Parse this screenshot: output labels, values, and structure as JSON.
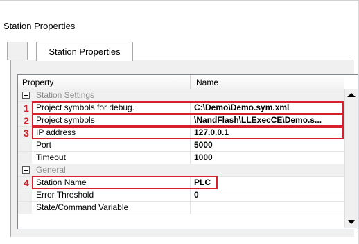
{
  "page": {
    "title": "Station Properties"
  },
  "tabs": [
    {
      "label": "Station Properties",
      "active": true
    }
  ],
  "grid": {
    "headers": {
      "property": "Property",
      "name": "Name"
    },
    "categories": {
      "station_settings": "Station Settings",
      "general": "General"
    },
    "rows": [
      {
        "property": "Project symbols for debug.",
        "value": "C:\\Demo\\Demo.sym.xml"
      },
      {
        "property": "Project symbols",
        "value": "\\NandFlash\\LLExecCE\\Demo.s..."
      },
      {
        "property": "IP address",
        "value": "127.0.0.1"
      },
      {
        "property": "Port",
        "value": "5000"
      },
      {
        "property": "Timeout",
        "value": "1000"
      },
      {
        "property": "Station Name",
        "value": "PLC"
      },
      {
        "property": "Error Threshold",
        "value": "0"
      },
      {
        "property": "State/Command Variable",
        "value": ""
      }
    ]
  },
  "annotations": [
    "1",
    "2",
    "3",
    "4"
  ],
  "colors": {
    "highlight": "#d6202b",
    "category_text": "#8c8c8c"
  },
  "icons": {
    "collapse": "minus-box-icon",
    "scroll_up": "arrow-up-icon",
    "scroll_down": "arrow-down-icon"
  }
}
